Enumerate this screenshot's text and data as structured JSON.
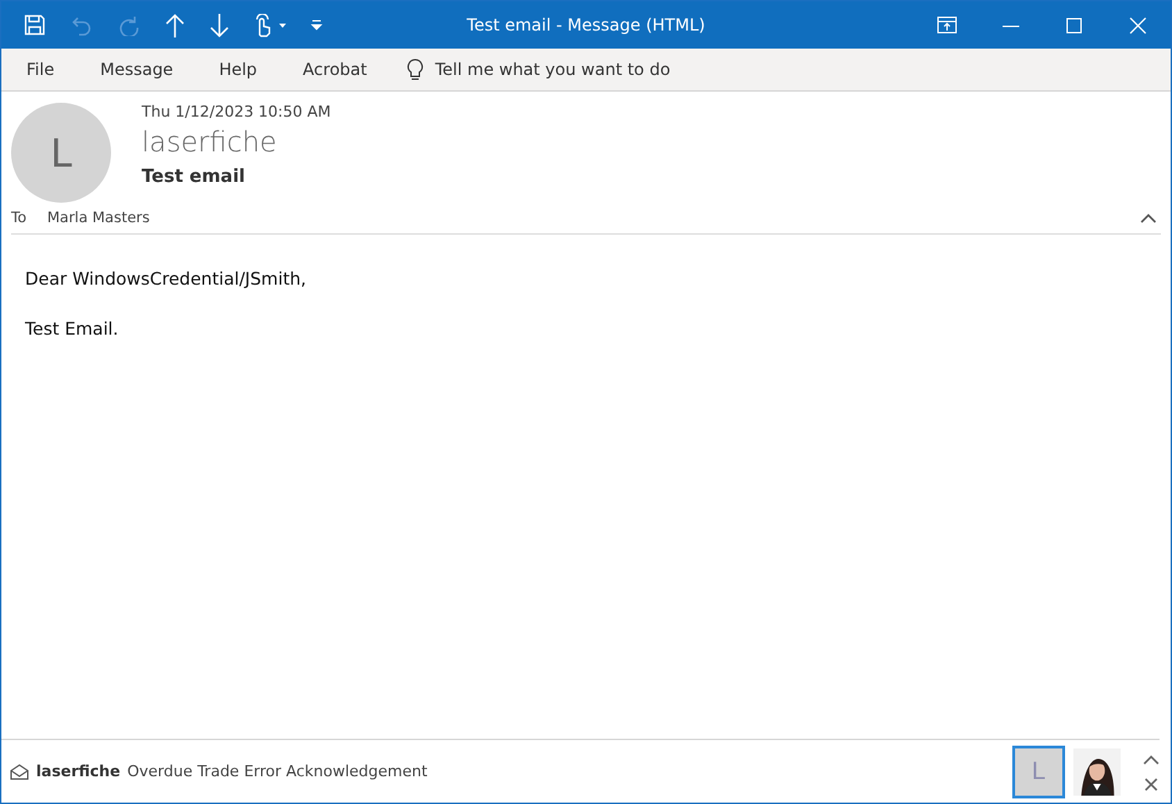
{
  "window": {
    "title": "Test email  -  Message (HTML)"
  },
  "quick_access": [
    {
      "kind": "save",
      "disabled": false
    },
    {
      "kind": "undo",
      "disabled": true
    },
    {
      "kind": "redo",
      "disabled": true
    },
    {
      "kind": "up",
      "disabled": false
    },
    {
      "kind": "down",
      "disabled": false
    },
    {
      "kind": "touch",
      "disabled": false
    },
    {
      "kind": "customize",
      "disabled": false
    }
  ],
  "menu": [
    "File",
    "Message",
    "Help",
    "Acrobat"
  ],
  "tell_me": {
    "placeholder": "Tell me what you want to do"
  },
  "message": {
    "avatar": "L",
    "date": "Thu 1/12/2023 10:50 AM",
    "sender": "laserfiche",
    "subject": "Test email",
    "to_label": "To",
    "to": "Marla Masters"
  },
  "body": [
    "Dear WindowsCredential/JSmith,",
    "Test Email."
  ],
  "people_pane": {
    "sender": "laserfiche",
    "subject": "Overdue Trade Error Acknowledgement",
    "people": [
      {
        "kind": "initial",
        "text": "L",
        "selected": true
      },
      {
        "kind": "picture",
        "selected": false
      }
    ]
  }
}
